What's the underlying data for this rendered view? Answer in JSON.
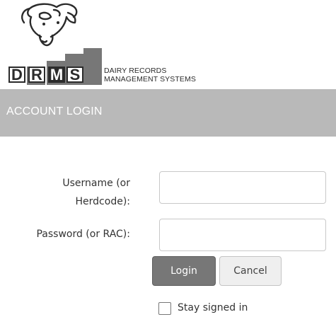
{
  "logo": {
    "letters": [
      "D",
      "R",
      "M",
      "S"
    ],
    "line1": "DAIRY RECORDS",
    "line2": "MANAGEMENT SYSTEMS"
  },
  "header": {
    "title": "ACCOUNT LOGIN"
  },
  "form": {
    "username_label_line1": "Username (or",
    "username_label_line2": "Herdcode):",
    "username_value": "",
    "password_label": "Password (or RAC):",
    "password_value": "",
    "login_label": "Login",
    "cancel_label": "Cancel",
    "stay_signed_in_label": "Stay signed in",
    "stay_signed_in_checked": false
  },
  "colors": {
    "header_band": "#b9b9b9",
    "login_button": "#777777",
    "logo_dark": "#2b2b2b"
  }
}
